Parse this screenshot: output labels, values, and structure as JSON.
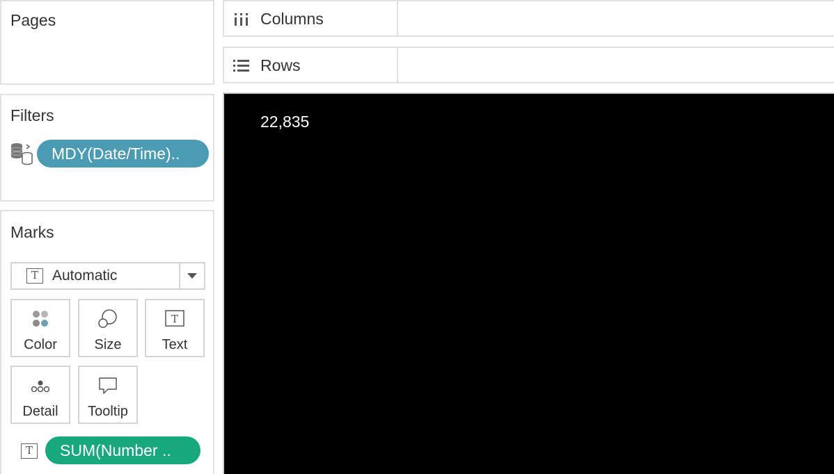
{
  "pages": {
    "title": "Pages"
  },
  "shelves": {
    "columns": {
      "label": "Columns",
      "icon": "columns-icon"
    },
    "rows": {
      "label": "Rows",
      "icon": "rows-icon"
    }
  },
  "filters": {
    "title": "Filters",
    "items": [
      {
        "label": "MDY(Date/Time)..",
        "icon": "database-icon",
        "color": "#4b9bb5"
      }
    ]
  },
  "marks": {
    "title": "Marks",
    "mark_type": {
      "value": "Automatic",
      "icon": "text-mark-icon"
    },
    "buttons": [
      {
        "label": "Color",
        "icon": "color-icon"
      },
      {
        "label": "Size",
        "icon": "size-icon"
      },
      {
        "label": "Text",
        "icon": "text-icon"
      },
      {
        "label": "Detail",
        "icon": "detail-icon"
      },
      {
        "label": "Tooltip",
        "icon": "tooltip-icon"
      }
    ],
    "fields": [
      {
        "label": "SUM(Number ..",
        "icon": "text-mark-icon",
        "color": "#17a87b"
      }
    ]
  },
  "viz": {
    "value": "22,835",
    "background": "#000000",
    "text_color": "#ffffff"
  }
}
